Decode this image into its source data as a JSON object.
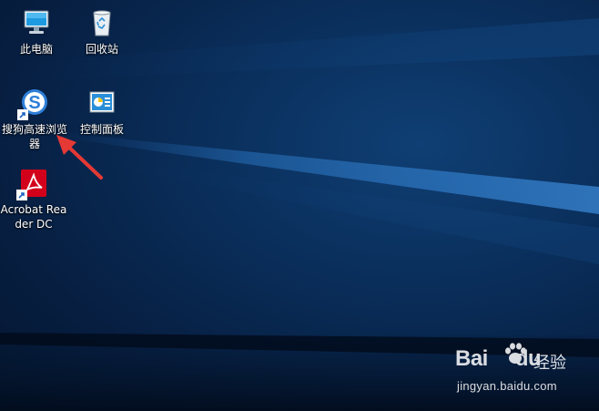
{
  "desktop": {
    "icons": [
      {
        "label": "此电脑",
        "icon": "computer-icon"
      },
      {
        "label": "回收站",
        "icon": "recycle-bin-icon"
      },
      {
        "label": "搜狗高速浏览器",
        "icon": "sogou-browser-icon"
      },
      {
        "label": "控制面板",
        "icon": "control-panel-icon"
      },
      {
        "label": "Acrobat Reader DC",
        "icon": "acrobat-reader-icon"
      }
    ]
  },
  "annotation": {
    "arrow_color": "#e53935"
  },
  "watermark": {
    "brand": "Bai",
    "brand_tail": "du",
    "suffix": "经验",
    "site": "jingyan.baidu.com"
  }
}
